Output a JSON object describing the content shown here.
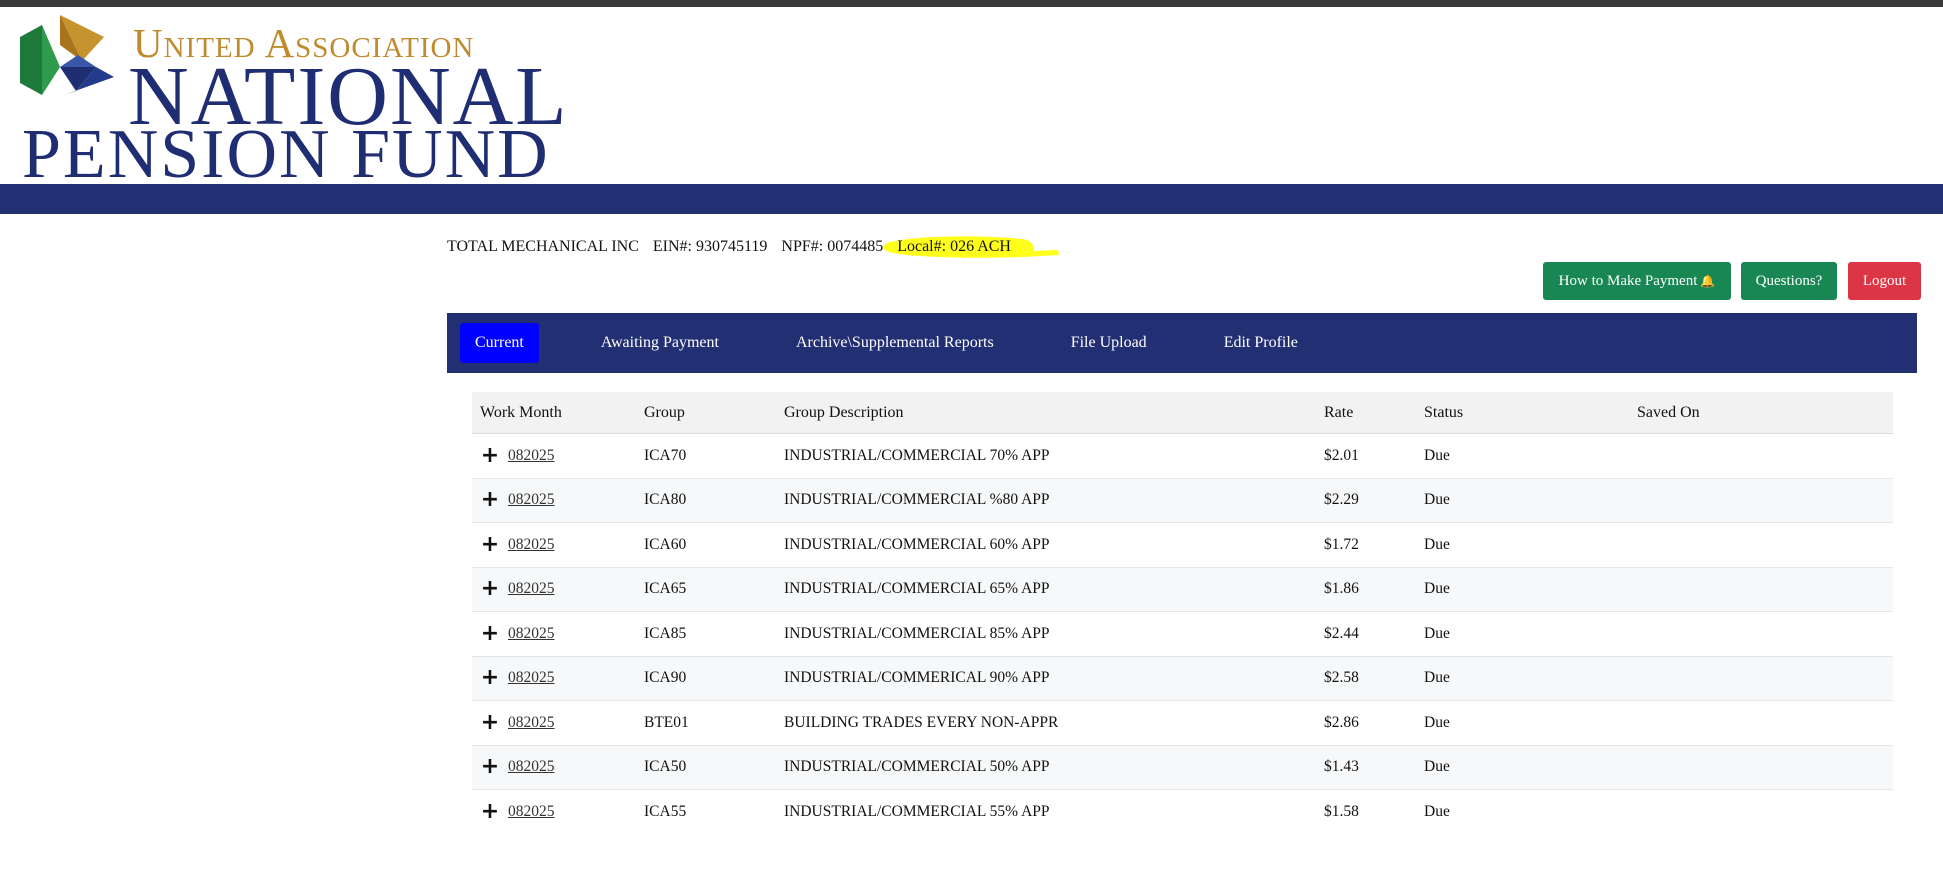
{
  "logo": {
    "line1": "United Association",
    "line2": "NATIONAL",
    "line3": "PENSION FUND"
  },
  "employer": {
    "name": "TOTAL MECHANICAL INC",
    "ein": "EIN#: 930745119",
    "npf": "NPF#: 0074485",
    "local": "Local#: 026 ACH"
  },
  "buttons": {
    "how_to_pay": "How to Make Payment",
    "questions": "Questions?",
    "logout": "Logout"
  },
  "nav": {
    "current": "Current",
    "awaiting": "Awaiting Payment",
    "archive": "Archive\\Supplemental Reports",
    "upload": "File Upload",
    "profile": "Edit Profile"
  },
  "table": {
    "headers": {
      "work_month": "Work Month",
      "group": "Group",
      "description": "Group Description",
      "rate": "Rate",
      "status": "Status",
      "saved_on": "Saved On"
    },
    "rows": [
      {
        "month": "082025",
        "group": "ICA70",
        "desc": "INDUSTRIAL/COMMERCIAL 70% APP",
        "rate": "$2.01",
        "status": "Due",
        "saved": ""
      },
      {
        "month": "082025",
        "group": "ICA80",
        "desc": "INDUSTRIAL/COMMERCIAL %80 APP",
        "rate": "$2.29",
        "status": "Due",
        "saved": ""
      },
      {
        "month": "082025",
        "group": "ICA60",
        "desc": "INDUSTRIAL/COMMERCIAL 60% APP",
        "rate": "$1.72",
        "status": "Due",
        "saved": ""
      },
      {
        "month": "082025",
        "group": "ICA65",
        "desc": "INDUSTRIAL/COMMERCIAL 65% APP",
        "rate": "$1.86",
        "status": "Due",
        "saved": ""
      },
      {
        "month": "082025",
        "group": "ICA85",
        "desc": "INDUSTRIAL/COMMERCIAL 85% APP",
        "rate": "$2.44",
        "status": "Due",
        "saved": ""
      },
      {
        "month": "082025",
        "group": "ICA90",
        "desc": "INDUSTRIAL/COMMERICAL 90% APP",
        "rate": "$2.58",
        "status": "Due",
        "saved": ""
      },
      {
        "month": "082025",
        "group": "BTE01",
        "desc": "BUILDING TRADES EVERY NON-APPR",
        "rate": "$2.86",
        "status": "Due",
        "saved": ""
      },
      {
        "month": "082025",
        "group": "ICA50",
        "desc": "INDUSTRIAL/COMMERCIAL 50% APP",
        "rate": "$1.43",
        "status": "Due",
        "saved": ""
      },
      {
        "month": "082025",
        "group": "ICA55",
        "desc": "INDUSTRIAL/COMMERCIAL 55% APP",
        "rate": "$1.58",
        "status": "Due",
        "saved": ""
      }
    ]
  }
}
